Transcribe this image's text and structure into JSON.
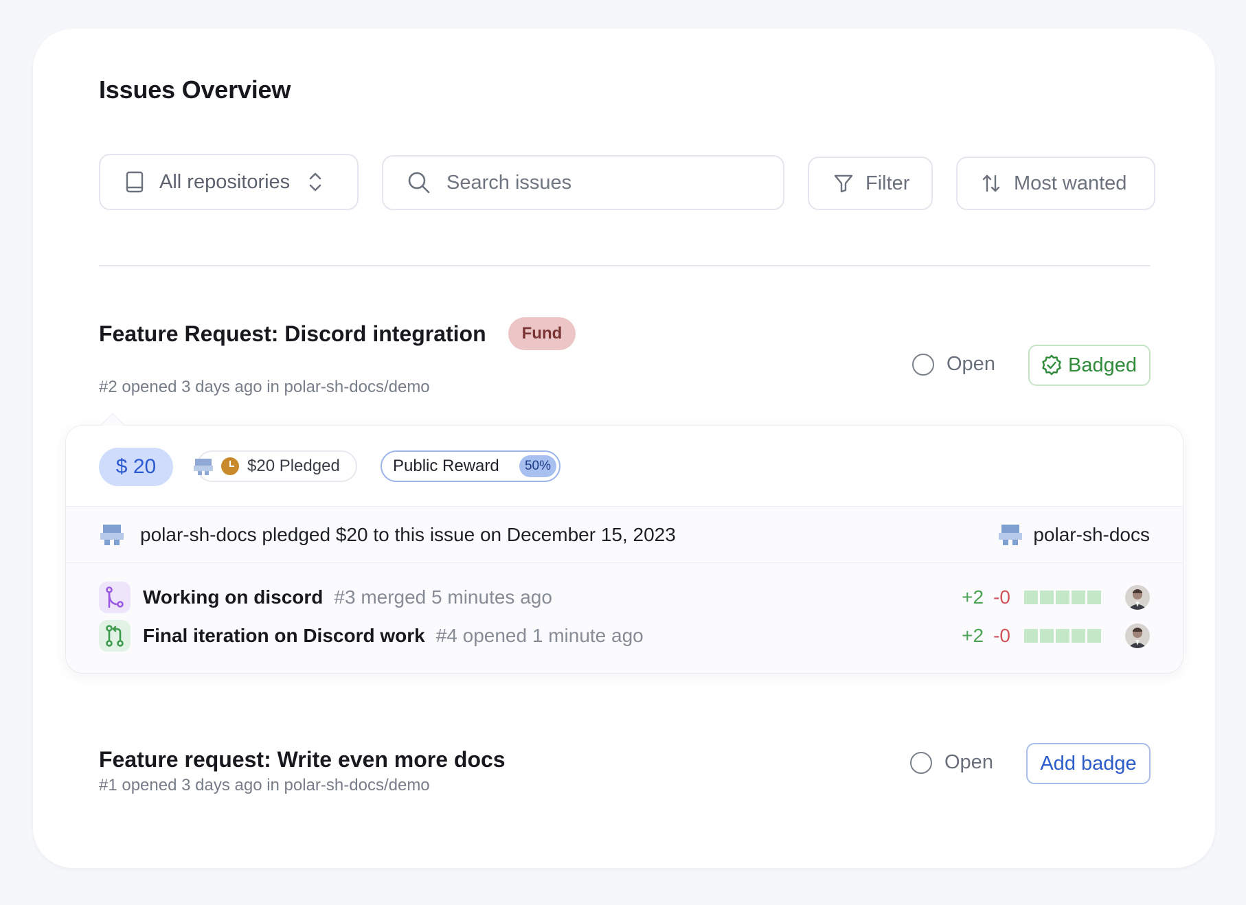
{
  "page": {
    "title": "Issues Overview"
  },
  "toolbar": {
    "repo_label": "All repositories",
    "search_placeholder": "Search issues",
    "filter_label": "Filter",
    "sort_label": "Most wanted"
  },
  "issues": [
    {
      "title": "Feature Request: Discord integration",
      "tag": "Fund",
      "meta": "#2 opened 3 days ago in polar-sh-docs/demo",
      "state": "Open",
      "badge_label": "Badged",
      "funding": {
        "amount": "$ 20",
        "pledged": "$20 Pledged",
        "reward_label": "Public Reward",
        "reward_pct": "50%",
        "pledge_text": "polar-sh-docs pledged $20 to this issue on December 15, 2023",
        "pledger": "polar-sh-docs"
      },
      "pull_requests": [
        {
          "title": "Working on discord",
          "meta": "#3 merged 5 minutes ago",
          "additions": "+2",
          "deletions": "-0",
          "status": "merged"
        },
        {
          "title": "Final iteration on Discord work",
          "meta": "#4 opened 1 minute ago",
          "additions": "+2",
          "deletions": "-0",
          "status": "open"
        }
      ]
    },
    {
      "title": "Feature request: Write even more docs",
      "meta": "#1 opened 3 days ago in polar-sh-docs/demo",
      "state": "Open",
      "badge_label": "Add badge"
    }
  ],
  "colors": {
    "fund_bg": "#ecc6c6",
    "badged_green": "#2f8a3a",
    "add_badge_blue": "#2b5cc9",
    "additions_green": "#4aa356",
    "deletions_red": "#d0545a",
    "amount_bg": "#cfdcfb"
  },
  "icons": {
    "repo": "book-icon",
    "updown": "chevron-up-down-icon",
    "search": "search-icon",
    "filter": "funnel-icon",
    "sort": "arrows-up-down-icon",
    "open": "circle-icon",
    "badged": "check-badge-icon",
    "merged_pr": "git-merge-icon",
    "open_pr": "git-pull-request-icon"
  }
}
